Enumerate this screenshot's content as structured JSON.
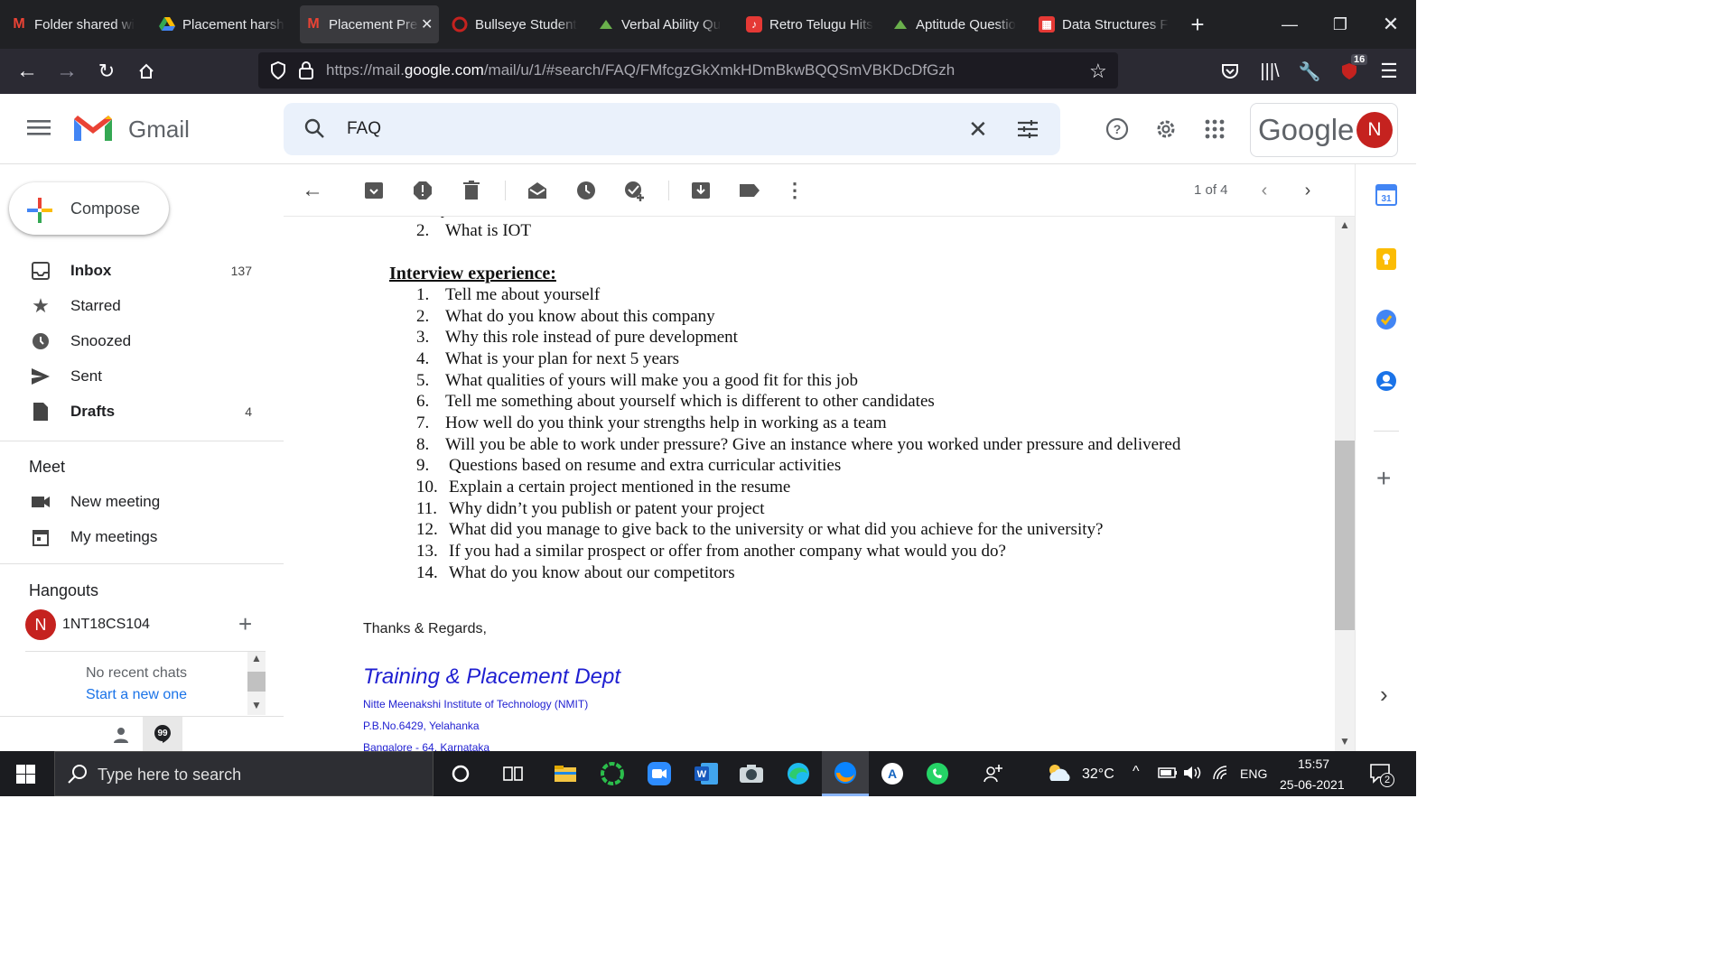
{
  "browser": {
    "tabs": [
      {
        "label": "Folder shared wi",
        "icon": "gmail-icon"
      },
      {
        "label": "Placement harsh",
        "icon": "google-drive-icon"
      },
      {
        "label": "Placement Pre",
        "icon": "gmail-icon",
        "active": true
      },
      {
        "label": "Bullseye Student",
        "icon": "bullseye-icon"
      },
      {
        "label": "Verbal Ability Qu",
        "icon": "indiabix-icon"
      },
      {
        "label": "Retro Telugu Hits",
        "icon": "music-icon"
      },
      {
        "label": "Aptitude Questio",
        "icon": "indiabix-icon"
      },
      {
        "label": "Data Structures F",
        "icon": "geeks-icon"
      }
    ],
    "url_prefix": "https://mail.",
    "url_domain": "google.com",
    "url_rest": "/mail/u/1/#search/FAQ/FMfcgzGkXmkHDmBkwBQQSmVBKDcDfGzh",
    "extension_badge": "16"
  },
  "gmail": {
    "logo_text": "Gmail",
    "search_value": "FAQ",
    "google_text": "Google",
    "avatar_letter": "N",
    "compose_label": "Compose",
    "nav": [
      {
        "label": "Inbox",
        "count": "137",
        "bold": true,
        "icon": "inbox-icon"
      },
      {
        "label": "Starred",
        "count": "",
        "bold": false,
        "icon": "star-icon"
      },
      {
        "label": "Snoozed",
        "count": "",
        "bold": false,
        "icon": "clock-icon"
      },
      {
        "label": "Sent",
        "count": "",
        "bold": false,
        "icon": "send-icon"
      },
      {
        "label": "Drafts",
        "count": "4",
        "bold": true,
        "icon": "draft-icon"
      }
    ],
    "meet": {
      "title": "Meet",
      "new_meeting": "New meeting",
      "my_meetings": "My meetings"
    },
    "hangouts": {
      "title": "Hangouts",
      "user_letter": "N",
      "user_name": "1NT18CS104",
      "no_chats": "No recent chats",
      "start_chat": "Start a new one"
    },
    "pagination": "1 of 4"
  },
  "email": {
    "prev_item": {
      "num": "2.",
      "text": "What is IOT"
    },
    "section_title": "Interview experience:",
    "questions": [
      {
        "num": "1.",
        "text": "Tell me about yourself"
      },
      {
        "num": "2.",
        "text": "What do you know about this company"
      },
      {
        "num": "3.",
        "text": "Why this role instead of pure development"
      },
      {
        "num": "4.",
        "text": "What is your plan for next 5 years"
      },
      {
        "num": "5.",
        "text": "What qualities of yours will make you a good fit for this job"
      },
      {
        "num": "6.",
        "text": "Tell me something about yourself which is different to other candidates"
      },
      {
        "num": "7.",
        "text": "How well do you think your strengths help in working as a team"
      },
      {
        "num": "8.",
        "text": "Will you be able to work under pressure? Give an instance where you worked under pressure and delivered"
      },
      {
        "num": "9.",
        "text": "Questions based on resume and extra curricular activities"
      },
      {
        "num": "10.",
        "text": "Explain a certain project mentioned in the resume"
      },
      {
        "num": "11.",
        "text": "Why didn’t you publish or patent your project"
      },
      {
        "num": "12.",
        "text": "What did you manage to give back to the university or what did you achieve for the university?"
      },
      {
        "num": "13.",
        "text": "If you had a similar prospect or offer from another company what would you do?"
      },
      {
        "num": "14.",
        "text": "What do you know about our competitors"
      }
    ],
    "regards": "Thanks & Regards,",
    "signature_title": "Training & Placement Dept",
    "sig_line1": "Nitte Meenakshi Institute of Technology (NMIT)",
    "sig_line2": "P.B.No.6429, Yelahanka",
    "sig_line3": "Bangalore - 64, Karnataka"
  },
  "taskbar": {
    "search_placeholder": "Type here to search",
    "weather": "32°C",
    "language": "ENG",
    "time": "15:57",
    "date": "25-06-2021",
    "notifications": "2"
  },
  "colors": {
    "accent_blue": "#1a73e8",
    "avatar_red": "#c5221f",
    "signature_blue": "#1f1fd1"
  }
}
